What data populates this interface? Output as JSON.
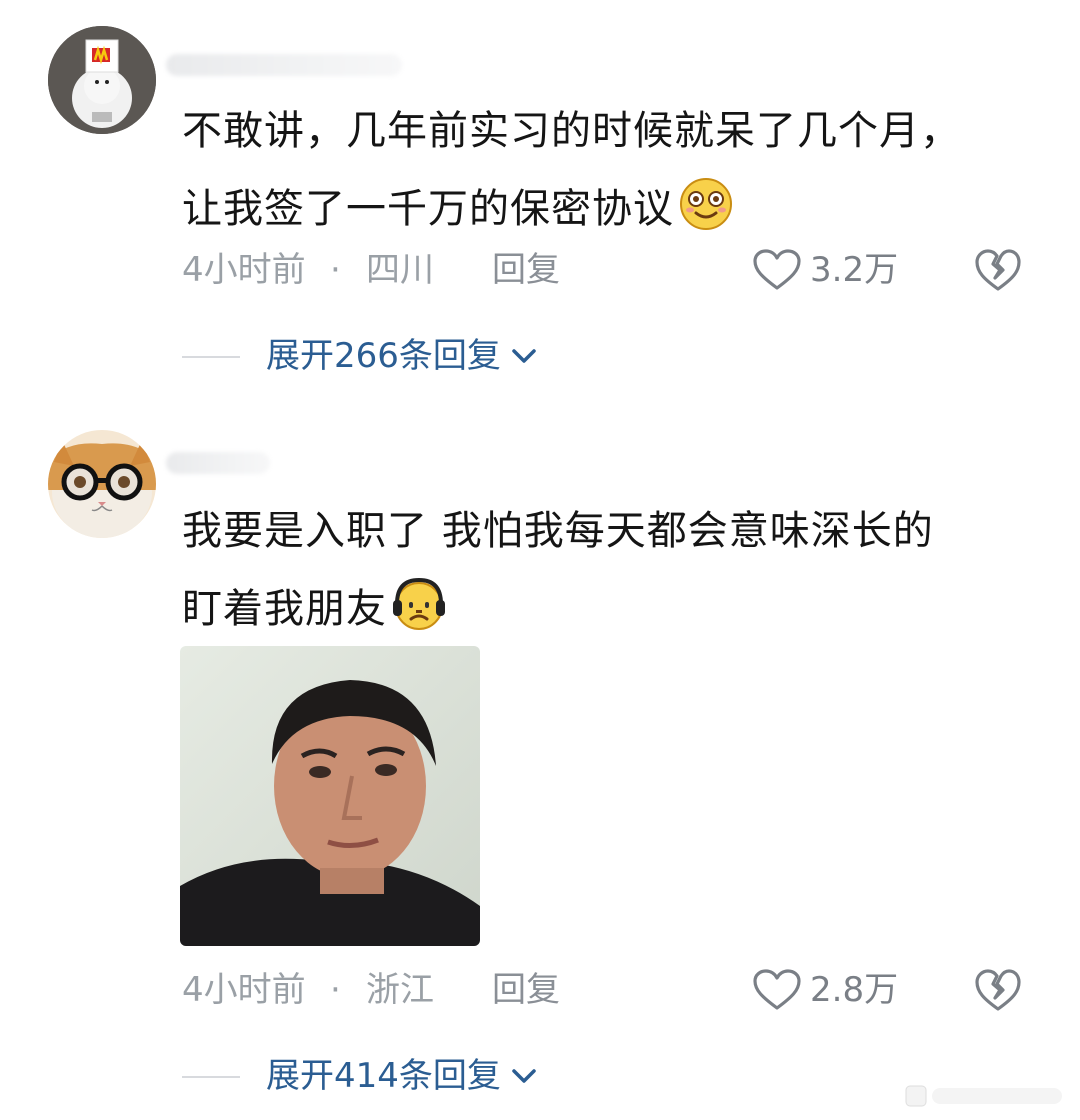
{
  "comments": [
    {
      "text_line1": "不敢讲，几年前实习的时候就呆了几个月，",
      "text_line2": "让我签了一千万的保密协议",
      "emoji": "dizzy-eyes-emoji",
      "time": "4小时前",
      "separator": "·",
      "location": "四川",
      "reply_label": "回复",
      "likes": "3.2万",
      "expand_label": "展开266条回复"
    },
    {
      "text_line1": "我要是入职了 我怕我每天都会意味深长的",
      "text_line2": "盯着我朋友",
      "emoji": "headphone-sad-emoji",
      "has_image": true,
      "time": "4小时前",
      "separator": "·",
      "location": "浙江",
      "reply_label": "回复",
      "likes": "2.8万",
      "expand_label": "展开414条回复"
    }
  ],
  "icons": {
    "like": "heart-outline-icon",
    "dislike": "broken-heart-icon",
    "expand": "chevron-down-icon"
  },
  "colors": {
    "link": "#2b5d92",
    "meta": "#9aa0a6",
    "text": "#151515"
  }
}
